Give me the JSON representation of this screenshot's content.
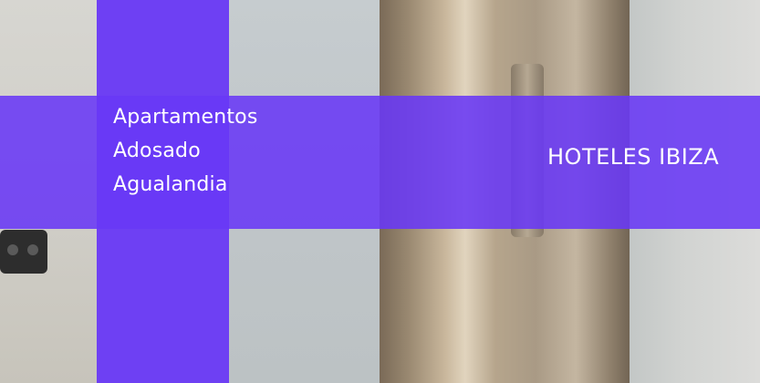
{
  "banner": {
    "title_lines": [
      "Apartamentos",
      "Adosado",
      "Agualandia"
    ],
    "brand": "HOTELES IBIZA"
  },
  "colors": {
    "overlay_purple": "#6938F6",
    "text": "#FFFFFF"
  }
}
